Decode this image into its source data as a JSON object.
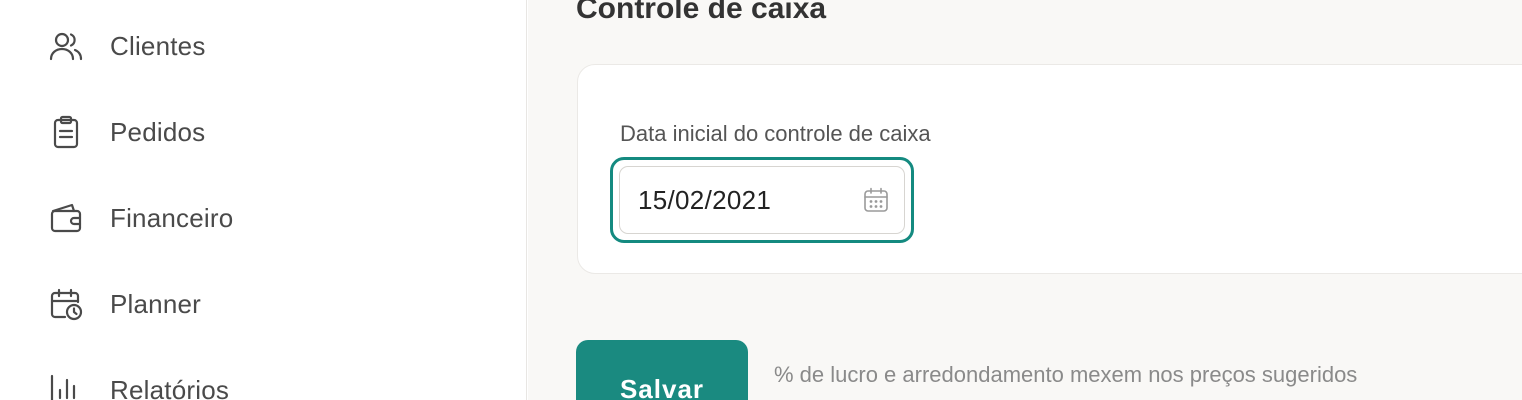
{
  "sidebar": {
    "items": [
      {
        "label": "Clientes",
        "icon": "users-icon"
      },
      {
        "label": "Pedidos",
        "icon": "clipboard-icon"
      },
      {
        "label": "Financeiro",
        "icon": "wallet-icon"
      },
      {
        "label": "Planner",
        "icon": "calendar-clock-icon"
      },
      {
        "label": "Relatórios",
        "icon": "bar-chart-icon"
      }
    ]
  },
  "main": {
    "title": "Controle de caixa",
    "field": {
      "label": "Data inicial do controle de caixa",
      "value": "15/02/2021",
      "icon": "calendar-icon"
    },
    "save_label": "Salvar",
    "hint": "% de lucro e arredondamento mexem nos preços sugeridos"
  },
  "colors": {
    "accent": "#1a8a80",
    "focus_ring": "#148a80",
    "main_background": "#f9f8f6",
    "sidebar_text": "#4a4a4a"
  }
}
